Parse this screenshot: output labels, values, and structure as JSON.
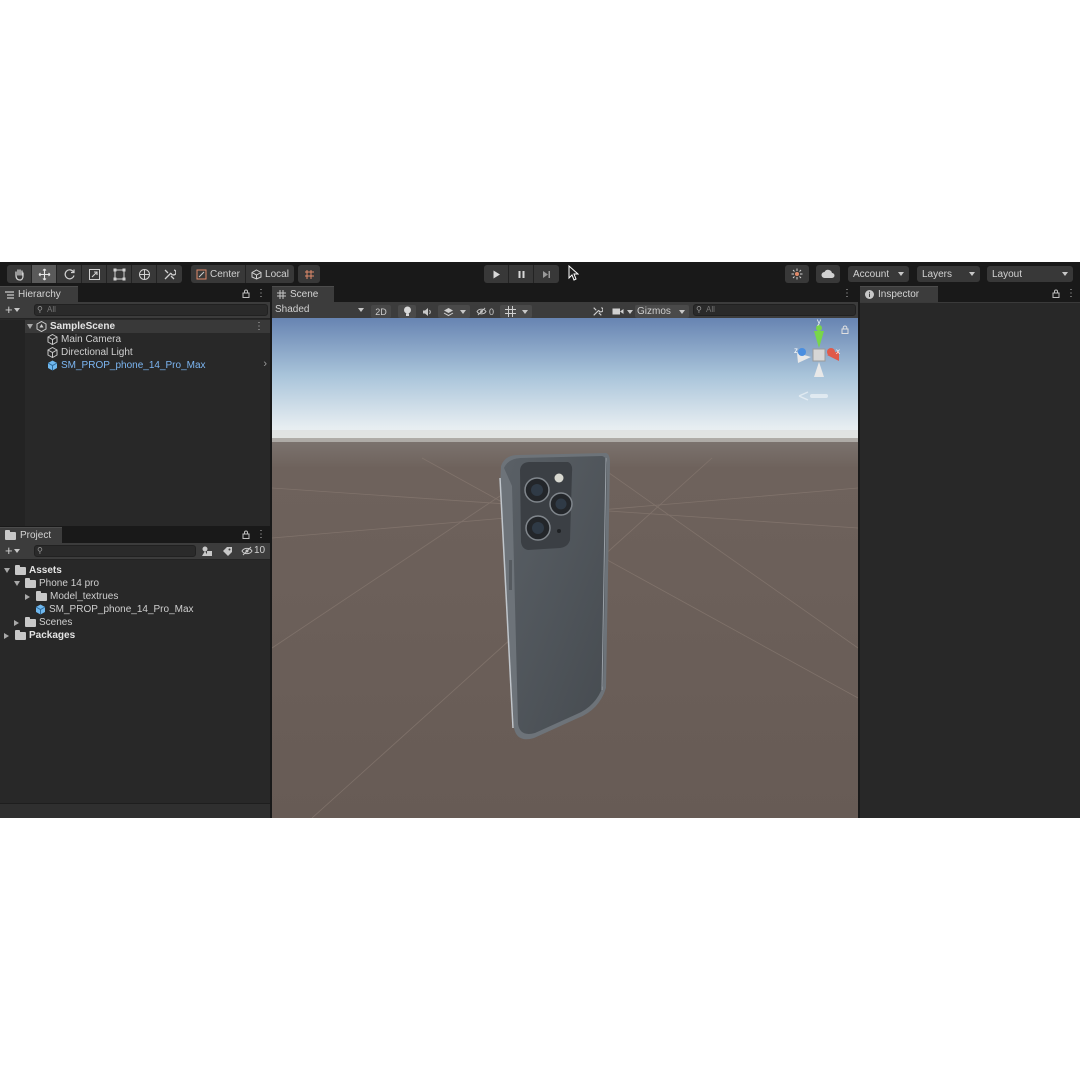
{
  "toolbar": {
    "tools": [
      {
        "name": "hand-tool",
        "icon": "hand-icon",
        "active": false
      },
      {
        "name": "move-tool",
        "icon": "move-arrows-icon",
        "active": true
      },
      {
        "name": "rotate-tool",
        "icon": "rotate-icon",
        "active": false
      },
      {
        "name": "scale-tool",
        "icon": "scale-icon",
        "active": false
      },
      {
        "name": "rect-tool",
        "icon": "rect-transform-icon",
        "active": false
      },
      {
        "name": "transform-tool",
        "icon": "transform-icon",
        "active": false
      },
      {
        "name": "custom-tool",
        "icon": "custom-tools-icon",
        "active": false
      }
    ],
    "pivot_mode": "Center",
    "pivot_rotation": "Local",
    "account_label": "Account",
    "layers_label": "Layers",
    "layout_label": "Layout"
  },
  "hierarchy": {
    "tab_label": "Hierarchy",
    "search_placeholder": "All",
    "scene_name": "SampleScene",
    "items": [
      {
        "label": "Main Camera",
        "icon": "gameobject-icon"
      },
      {
        "label": "Directional Light",
        "icon": "gameobject-icon"
      },
      {
        "label": "SM_PROP_phone_14_Pro_Max",
        "icon": "prefab-icon"
      }
    ]
  },
  "project": {
    "tab_label": "Project",
    "hidden_count": "10",
    "tree": {
      "assets": "Assets",
      "phone_folder": "Phone 14 pro",
      "textures_folder": "Model_textrues",
      "phone_prefab": "SM_PROP_phone_14_Pro_Max",
      "scenes_folder": "Scenes",
      "packages": "Packages"
    }
  },
  "scene": {
    "tab_label": "Scene",
    "draw_mode": "Shaded",
    "mode_2d": "2D",
    "hidden_count": "0",
    "gizmos_label": "Gizmos",
    "search_placeholder": "All",
    "axis_labels": {
      "y": "y",
      "z": "z",
      "x": "x"
    }
  },
  "inspector": {
    "tab_label": "Inspector"
  },
  "colors": {
    "editor_bg": "#191919",
    "panel_bg": "#282828",
    "tab_bg": "#3c3c3c",
    "sky_top": "#6b8cb8",
    "horizon": "#e8eef2",
    "ground": "#6a5e58",
    "selection_blue": "#7cb6f2",
    "phone_body": "#4c5258"
  }
}
